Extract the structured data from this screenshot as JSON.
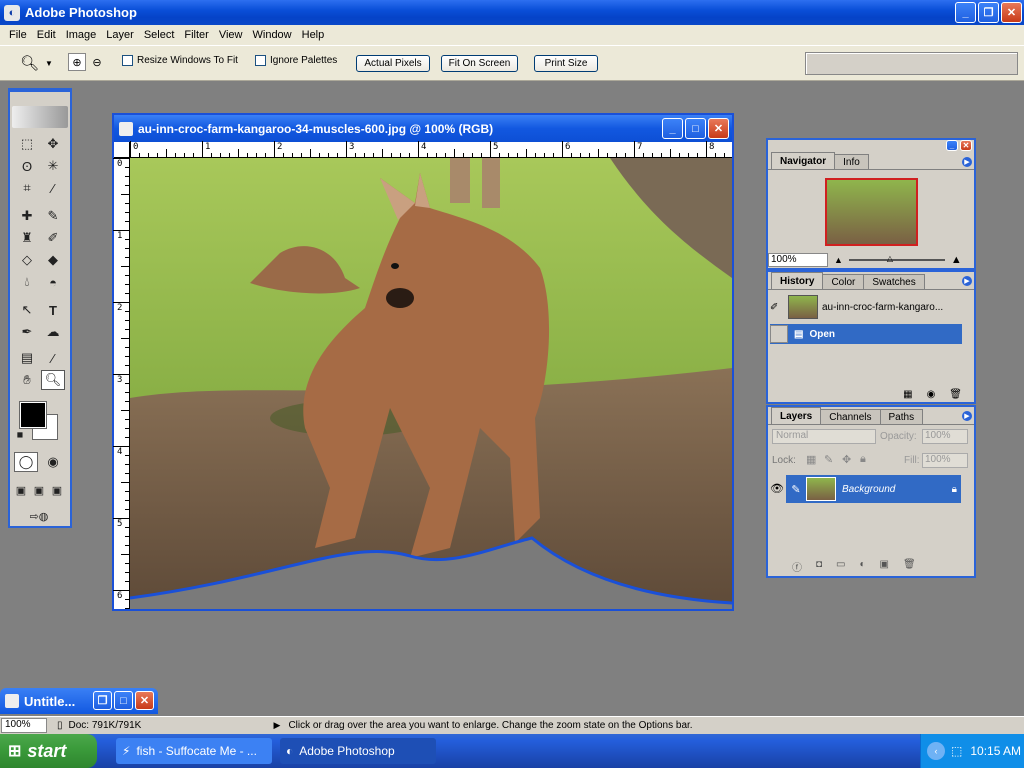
{
  "app": {
    "title": "Adobe Photoshop"
  },
  "menu": [
    "File",
    "Edit",
    "Image",
    "Layer",
    "Select",
    "Filter",
    "View",
    "Window",
    "Help"
  ],
  "options": {
    "resize_windows": "Resize Windows To Fit",
    "ignore_palettes": "Ignore Palettes",
    "actual_pixels": "Actual Pixels",
    "fit_on_screen": "Fit On Screen",
    "print_size": "Print Size"
  },
  "document": {
    "title": "au-inn-croc-farm-kangaroo-34-muscles-600.jpg @ 100% (RGB)",
    "hruler": [
      "0",
      "1",
      "2",
      "3",
      "4",
      "5",
      "6",
      "7",
      "8"
    ],
    "vruler": [
      "0",
      "1",
      "2",
      "3",
      "4",
      "5",
      "6"
    ]
  },
  "navigator": {
    "tabs": [
      "Navigator",
      "Info"
    ],
    "zoom": "100%"
  },
  "history": {
    "tabs": [
      "History",
      "Color",
      "Swatches"
    ],
    "snapshot": "au-inn-croc-farm-kangaro...",
    "step": "Open"
  },
  "layers": {
    "tabs": [
      "Layers",
      "Channels",
      "Paths"
    ],
    "blend_mode": "Normal",
    "opacity_label": "Opacity:",
    "opacity": "100%",
    "lock_label": "Lock:",
    "fill_label": "Fill:",
    "fill": "100%",
    "layer_name": "Background"
  },
  "minimized": {
    "title": "Untitle..."
  },
  "status": {
    "zoom": "100%",
    "doc": "Doc: 791K/791K",
    "hint": "Click or drag over the area you want to enlarge. Change the zoom state on the Options bar."
  },
  "taskbar": {
    "start": "start",
    "items": [
      "fish - Suffocate Me - ...",
      "Adobe Photoshop"
    ],
    "clock": "10:15 AM"
  }
}
